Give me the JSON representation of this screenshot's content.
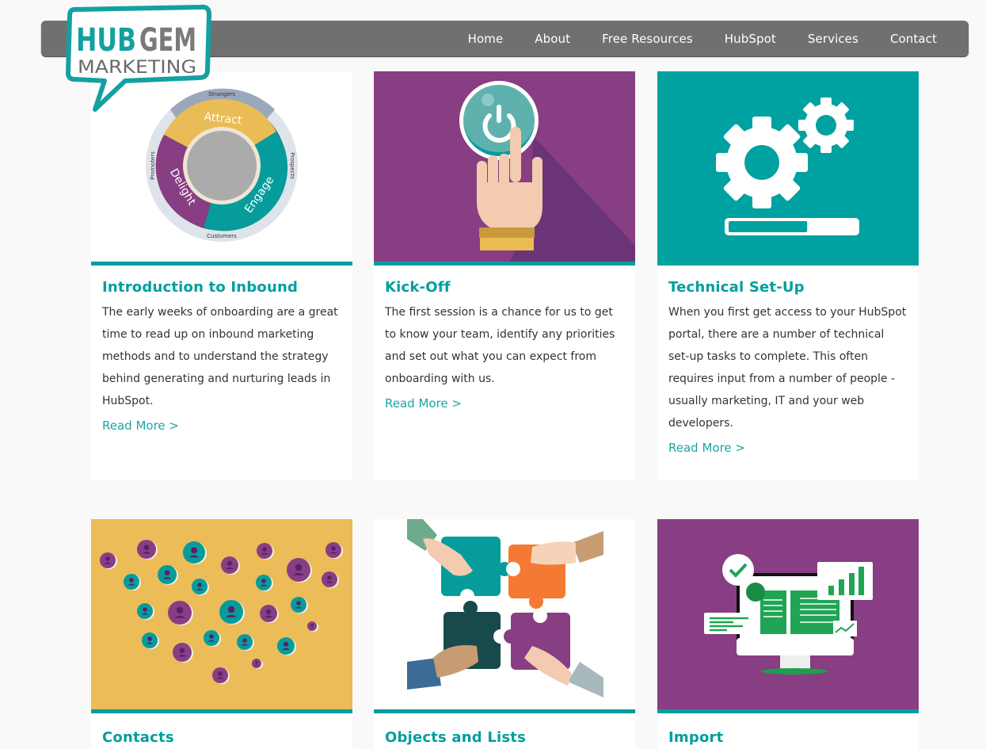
{
  "brand": {
    "logo_word1": "HUB",
    "logo_word2": "GEM",
    "logo_word3": "MARKETING",
    "teal": "#009e9e",
    "purple": "#883e82",
    "yellow": "#ebbc58",
    "nav_gray": "#707070"
  },
  "nav": {
    "items": [
      {
        "label": "Home"
      },
      {
        "label": "About"
      },
      {
        "label": "Free Resources"
      },
      {
        "label": "HubSpot"
      },
      {
        "label": "Services"
      },
      {
        "label": "Contact"
      }
    ]
  },
  "cards": [
    {
      "title": "Introduction to Inbound",
      "text": "The early weeks of onboarding are a great time to read up on inbound marketing methods and to understand the strategy behind generating and nurturing leads in HubSpot.",
      "link": "Read More >",
      "image": {
        "type": "flywheel-diagram",
        "labels": {
          "outer_top": "Strangers",
          "outer_right": "Prospects",
          "outer_bottom": "Customers",
          "outer_left": "Promoters",
          "seg1": "Attract",
          "seg2": "Engage",
          "seg3": "Delight"
        }
      }
    },
    {
      "title": "Kick-Off",
      "text": "The first session is a chance for us to get to know your team, identify any priorities and set out what you can expect from onboarding with us.",
      "link": "Read More >",
      "image": {
        "type": "hand-pressing-power-button"
      }
    },
    {
      "title": "Technical Set-Up",
      "text": "When you first get access to your HubSpot portal, there are a number of technical set-up tasks to complete. This often requires input from a number of people - usually marketing, IT and your web developers.",
      "link": "Read More >",
      "image": {
        "type": "gears-with-progress-bar",
        "progress": 0.62
      }
    },
    {
      "title": "Contacts",
      "image": {
        "type": "contact-avatars-cloud"
      }
    },
    {
      "title": "Objects and Lists",
      "image": {
        "type": "hands-with-puzzle-pieces"
      }
    },
    {
      "title": "Import",
      "image": {
        "type": "monitor-with-charts"
      }
    }
  ]
}
